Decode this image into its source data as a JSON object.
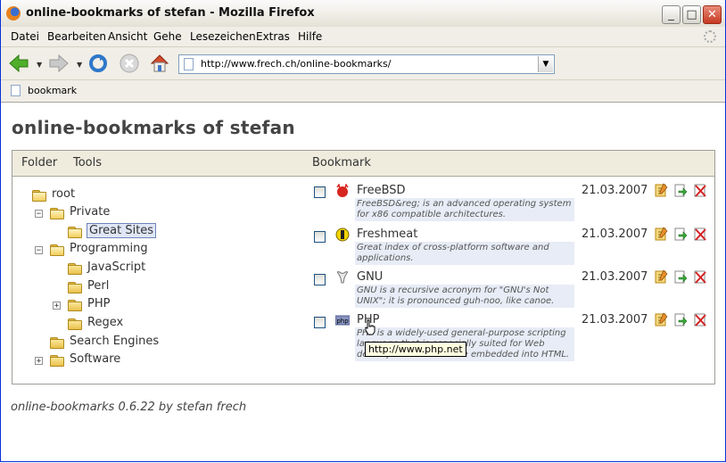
{
  "window": {
    "title": "online-bookmarks of stefan - Mozilla Firefox"
  },
  "window_controls": {
    "minimize": "_",
    "maximize": "□",
    "close": "✕"
  },
  "menu": {
    "items": [
      "Datei",
      "Bearbeiten",
      "Ansicht",
      "Gehe",
      "Lesezeichen",
      "Extras",
      "Hilfe"
    ]
  },
  "navigation": {
    "url": "http://www.frech.ch/online-bookmarks/"
  },
  "bookmarks_toolbar": {
    "items": [
      {
        "label": "bookmark"
      }
    ]
  },
  "page": {
    "title": "online-bookmarks of stefan",
    "headers": {
      "folder": "Folder",
      "tools": "Tools",
      "bookmark": "Bookmark"
    },
    "tree": [
      {
        "label": "root"
      },
      {
        "label": "Private",
        "expander": "−"
      },
      {
        "label": "Great Sites",
        "selected": true
      },
      {
        "label": "Programming",
        "expander": "−"
      },
      {
        "label": "JavaScript"
      },
      {
        "label": "Perl"
      },
      {
        "label": "PHP",
        "expander": "+"
      },
      {
        "label": "Regex"
      },
      {
        "label": "Search Engines"
      },
      {
        "label": "Software",
        "expander": "+"
      }
    ],
    "bookmarks": [
      {
        "name": "FreeBSD",
        "description": "FreeBSD&reg; is an advanced operating system for x86 compatible architectures.",
        "date": "21.03.2007",
        "icon": "freebsd-daemon-icon"
      },
      {
        "name": "Freshmeat",
        "description": "Great index of cross-platform software and applications.",
        "date": "21.03.2007",
        "icon": "freshmeat-icon"
      },
      {
        "name": "GNU",
        "description": "GNU is a recursive acronym for \"GNU's Not UNIX\"; it is pronounced guh-noo, like canoe.",
        "date": "21.03.2007",
        "icon": "gnu-icon"
      },
      {
        "name": "PHP",
        "description": "PHP is a widely-used general-purpose scripting language that is especially suited for Web development and can be embedded into HTML.",
        "date": "21.03.2007",
        "icon": "php-icon"
      }
    ],
    "tooltip": "http://www.php.net",
    "footer": "online-bookmarks 0.6.22 by stefan frech"
  }
}
